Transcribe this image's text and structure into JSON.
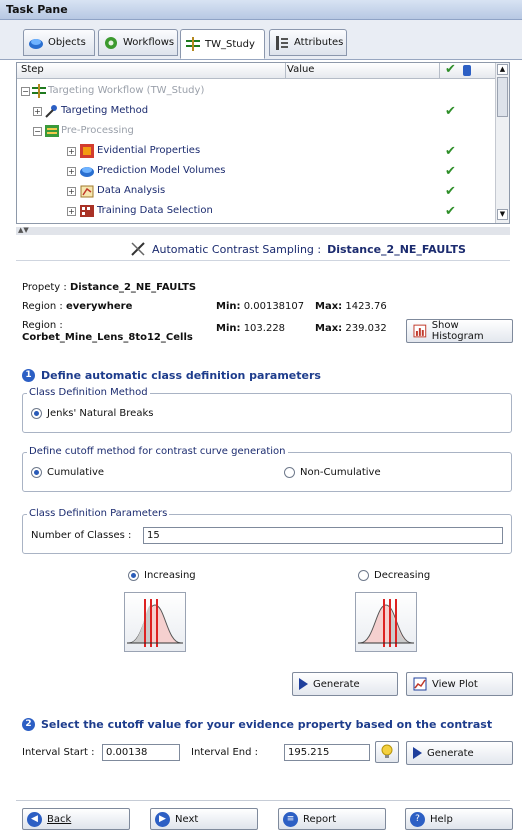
{
  "window": {
    "title": "Task Pane"
  },
  "tabs": [
    {
      "label": "Objects",
      "icon": "cube-icon"
    },
    {
      "label": "Workflows",
      "icon": "gear-icon"
    },
    {
      "label": "TW_Study",
      "icon": "study-icon",
      "active": true
    },
    {
      "label": "Attributes",
      "icon": "attributes-icon"
    }
  ],
  "tree": {
    "columns": {
      "step": "Step",
      "value": "Value"
    },
    "rows": [
      {
        "label": "Targeting Workflow (TW_Study)",
        "checked": false
      },
      {
        "label": "Targeting Method",
        "checked": true
      },
      {
        "label": "Pre-Processing",
        "checked": false
      },
      {
        "label": "Evidential Properties",
        "checked": true
      },
      {
        "label": "Prediction Model Volumes",
        "checked": true
      },
      {
        "label": "Data Analysis",
        "checked": true
      },
      {
        "label": "Training Data Selection",
        "checked": true
      }
    ]
  },
  "panel": {
    "title_prefix": "Automatic Contrast Sampling : ",
    "title_value": "Distance_2_NE_FAULTS"
  },
  "property": {
    "label": "Propety : ",
    "value": "Distance_2_NE_FAULTS",
    "region1_label": "Region : ",
    "region1_value": "everywhere",
    "region1_min_label": "Min:",
    "region1_min": "0.00138107",
    "region1_max_label": "Max:",
    "region1_max": "1423.76",
    "region2_label": "Region :",
    "region2_value": "Corbet_Mine_Lens_8to12_Cells",
    "region2_min_label": "Min:",
    "region2_min": "103.228",
    "region2_max_label": "Max:",
    "region2_max": "239.032",
    "histogram_button": "Show Histogram"
  },
  "section1": {
    "number": "1",
    "title": "Define automatic class definition parameters",
    "method_group": "Class Definition Method",
    "method_option": "Jenks' Natural Breaks",
    "cutoff_group": "Define cutoff method for contrast curve generation",
    "cutoff_cumulative": "Cumulative",
    "cutoff_noncumulative": "Non-Cumulative",
    "params_group": "Class Definition Parameters",
    "num_classes_label": "Number of Classes :",
    "num_classes_value": "15",
    "increasing_label": "Increasing",
    "decreasing_label": "Decreasing",
    "generate_button": "Generate",
    "view_plot_button": "View Plot"
  },
  "section2": {
    "number": "2",
    "title": "Select the cutoff value for your evidence property based on the contrast",
    "interval_start_label": "Interval Start :",
    "interval_start_value": "0.00138",
    "interval_end_label": "Interval End :",
    "interval_end_value": "195.215",
    "generate_button": "Generate"
  },
  "footer": {
    "back": "Back",
    "next": "Next",
    "report": "Report",
    "help": "Help"
  },
  "colors": {
    "accent": "#2c5fc4",
    "check": "#2f8f2a"
  }
}
